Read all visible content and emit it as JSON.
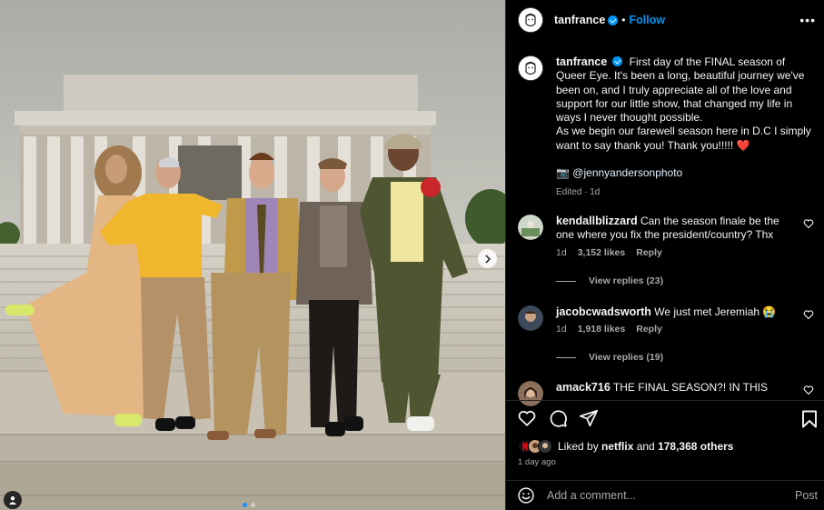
{
  "post": {
    "username": "tanfrance",
    "follow_label": "Follow",
    "separator": "•",
    "more_label": "•••",
    "caption_lines": [
      "First day of the FINAL season of Queer Eye. It's been a long, beautiful journey we've been on, and I truly appreciate all of the love and support for our little show, that changed my life in ways I never thought possible.",
      "As we begin our farewell season here in D.C I simply want to say thank you! Thank you!!!!! ❤️"
    ],
    "credit_emoji": "📷",
    "credit_handle": "@jennyandersonphoto",
    "edited_label": "Edited · 1d"
  },
  "comments": [
    {
      "username": "kendallblizzard",
      "text": "Can the season finale be the one where you fix the president/country? Thx",
      "age": "1d",
      "likes": "3,152 likes",
      "reply_label": "Reply",
      "view_replies": "View replies (23)"
    },
    {
      "username": "jacobcwadsworth",
      "text": "We just met Jeremiah 😭",
      "age": "1d",
      "likes": "1,918 likes",
      "reply_label": "Reply",
      "view_replies": "View replies (19)"
    },
    {
      "username": "amack716",
      "text": "THE FINAL SEASON?! IN THIS"
    }
  ],
  "likes": {
    "prefix": "Liked by ",
    "user": "netflix",
    "middle": " and ",
    "others": "178,368 others"
  },
  "timestamp": "1 day ago",
  "add_comment": {
    "placeholder": "Add a comment...",
    "post_label": "Post"
  },
  "carousel": {
    "slides": 2,
    "active": 0
  },
  "colors": {
    "accent": "#0095f6",
    "panel_bg": "#000000",
    "muted": "#a8a8a8",
    "heart_red": "#ed4956"
  }
}
